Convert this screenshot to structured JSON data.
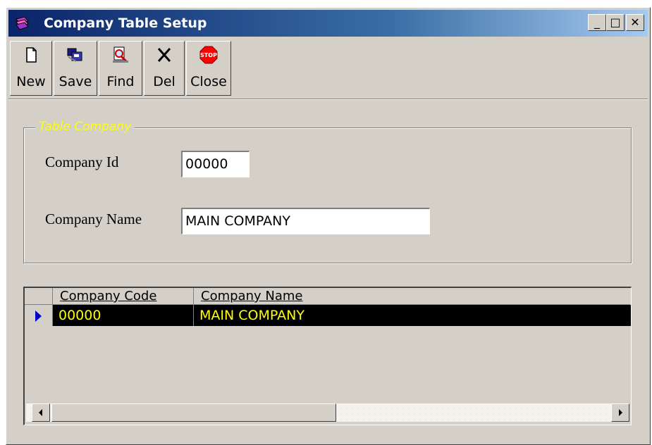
{
  "window": {
    "title": "Company Table Setup",
    "controls": {
      "minimize": "_",
      "maximize": "□",
      "close": "✕"
    }
  },
  "toolbar": {
    "buttons": [
      {
        "label": "New",
        "icon": "new-document-icon"
      },
      {
        "label": "Save",
        "icon": "save-icon"
      },
      {
        "label": "Find",
        "icon": "find-icon"
      },
      {
        "label": "Del",
        "icon": "delete-icon"
      },
      {
        "label": "Close",
        "icon": "stop-sign-icon"
      }
    ]
  },
  "group": {
    "legend": "Table Company",
    "fields": [
      {
        "label": "Company Id",
        "value": "00000"
      },
      {
        "label": "Company Name",
        "value": "MAIN COMPANY"
      }
    ]
  },
  "grid": {
    "columns": [
      "Company Code",
      "Company Name"
    ],
    "rows": [
      {
        "code": "00000",
        "name": "MAIN COMPANY",
        "selected": true
      }
    ]
  },
  "colors": {
    "title_gradient_start": "#0a246a",
    "face": "#d4d0c8",
    "legend": "#ffff00",
    "selected_row_bg": "#000000",
    "selected_row_text": "#ffff00",
    "row_pointer": "#0000cc"
  }
}
